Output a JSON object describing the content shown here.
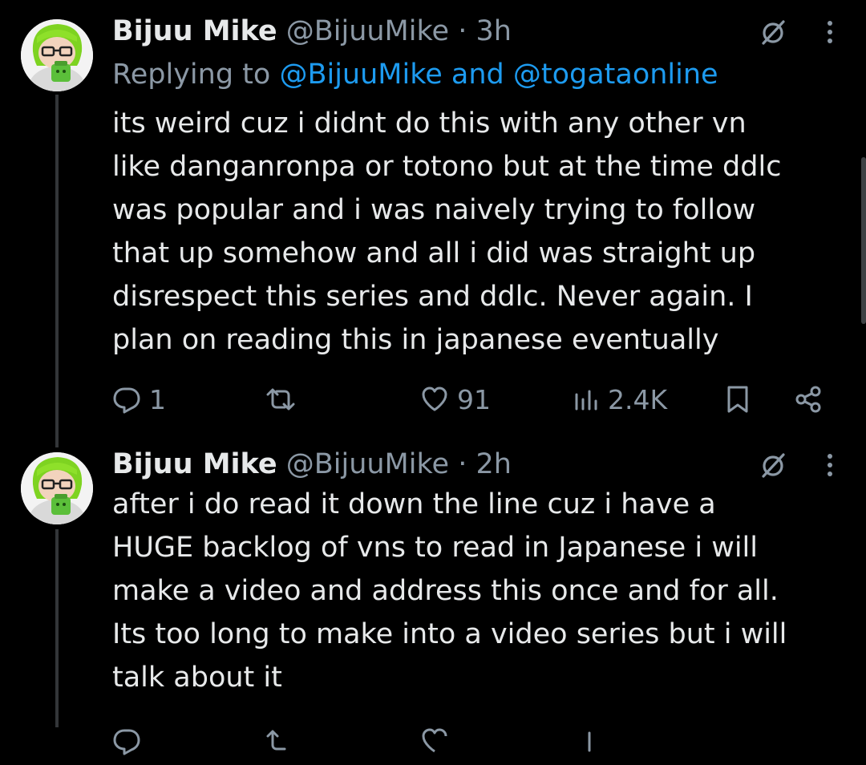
{
  "tweets": [
    {
      "name": "Bijuu Mike",
      "handle": "@BijuuMike",
      "sep": "·",
      "time": "3h",
      "reply_prefix": "Replying to ",
      "reply_targets": "@BijuuMike and @togataonline",
      "text": "its weird cuz i didnt do this with any other vn\nlike danganronpa or totono but at the time ddlc\nwas popular and i was naively trying to follow\nthat up somehow and all i did was straight up\ndisrespect this series and ddlc. Never again. I\nplan on reading this in japanese eventually",
      "replies": "1",
      "retweets": "",
      "likes": "91",
      "views": "2.4K"
    },
    {
      "name": "Bijuu Mike",
      "handle": "@BijuuMike",
      "sep": "·",
      "time": "2h",
      "text": "after i do read it down the line cuz i have a\nHUGE backlog of vns to read in Japanese i will\nmake a video and address this once and for all.\nIts too long to make into a video series but i will\ntalk about it"
    }
  ],
  "icons": {
    "grok": "slashed-circle-icon",
    "more": "more-vertical-icon",
    "reply": "reply-icon",
    "retweet": "retweet-icon",
    "like": "heart-icon",
    "views": "views-icon",
    "bookmark": "bookmark-icon",
    "share": "share-icon"
  },
  "colors": {
    "background": "#000000",
    "text": "#e7e9ea",
    "muted": "#8b98a5",
    "link": "#1d9bf0",
    "thread_line": "#333639"
  }
}
